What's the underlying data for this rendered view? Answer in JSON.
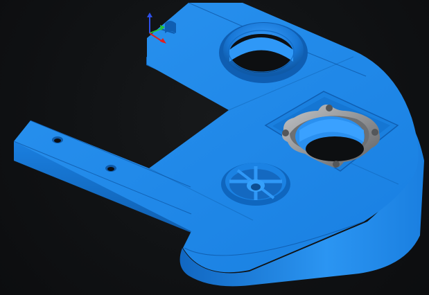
{
  "viewport": {
    "background": "#0f1113"
  },
  "model": {
    "color": "#1b86e8",
    "shade_color": "#0f5eb2",
    "highlight_color": "#41a7ff",
    "insert_color": "#8d8f92",
    "insert_highlight": "#c3c5c8",
    "insert_shadow": "#5c5e61"
  },
  "triad": {
    "x_axis_color": "#e02020",
    "y_axis_color": "#25c43a",
    "z_axis_color": "#2d4fe8"
  }
}
